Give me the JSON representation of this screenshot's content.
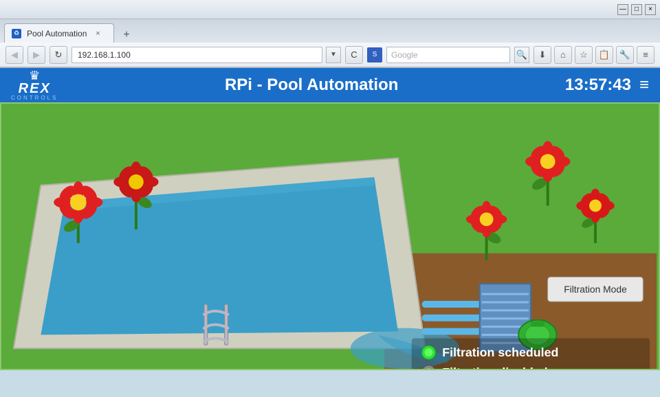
{
  "browser": {
    "tab_title": "Pool Automation",
    "tab_close": "×",
    "tab_new": "+",
    "back_btn": "◀",
    "forward_btn": "▶",
    "refresh_btn": "↻",
    "address": "192.168.1.100",
    "address_dropdown": "▼",
    "search_placeholder": "Google",
    "search_icon": "🔍",
    "download_btn": "⬇",
    "home_btn": "⌂",
    "bookmark_btn": "☆",
    "history_btn": "📋",
    "extensions_btn": "🔧",
    "menu_btn": "≡",
    "minimize": "—",
    "maximize": "□",
    "close": "×"
  },
  "header": {
    "logo_crown": "♛",
    "logo_text": "REX",
    "logo_sub": "CONTROLS",
    "title": "RPi - Pool Automation",
    "time": "13:57:43",
    "menu_icon": "≡"
  },
  "scene": {
    "filtration_mode_label": "Filtration Mode",
    "status1_label": "Filtration scheduled",
    "status2_label": "Filtration disabled"
  },
  "colors": {
    "grass": "#5aab3a",
    "pool_water": "#3a9ec8",
    "pool_surround": "#d8d8d0",
    "underground": "#8B5a2b",
    "header_bg": "#1a6ec8",
    "led_green": "#30e030",
    "led_gray": "#888888",
    "flower_red": "#e83030",
    "flower_yellow": "#f8d020"
  }
}
